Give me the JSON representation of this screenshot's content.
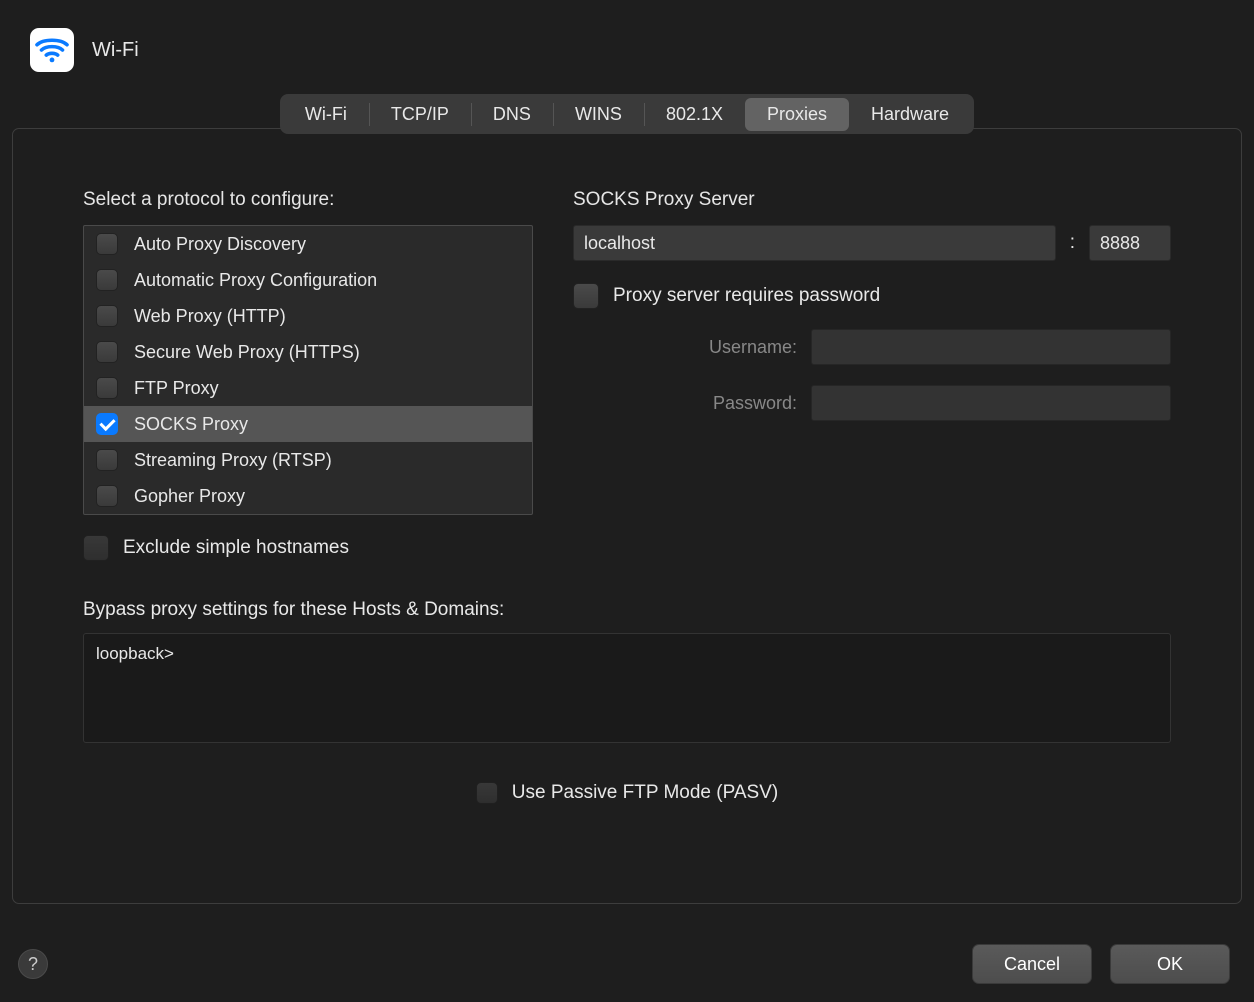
{
  "header": {
    "title": "Wi-Fi"
  },
  "tabs": {
    "items": [
      "Wi-Fi",
      "TCP/IP",
      "DNS",
      "WINS",
      "802.1X",
      "Proxies",
      "Hardware"
    ],
    "active": 5
  },
  "left": {
    "label": "Select a protocol to configure:",
    "protocols": [
      {
        "label": "Auto Proxy Discovery",
        "checked": false,
        "selected": false
      },
      {
        "label": "Automatic Proxy Configuration",
        "checked": false,
        "selected": false
      },
      {
        "label": "Web Proxy (HTTP)",
        "checked": false,
        "selected": false
      },
      {
        "label": "Secure Web Proxy (HTTPS)",
        "checked": false,
        "selected": false
      },
      {
        "label": "FTP Proxy",
        "checked": false,
        "selected": false
      },
      {
        "label": "SOCKS Proxy",
        "checked": true,
        "selected": true
      },
      {
        "label": "Streaming Proxy (RTSP)",
        "checked": false,
        "selected": false
      },
      {
        "label": "Gopher Proxy",
        "checked": false,
        "selected": false
      }
    ],
    "exclude_label": "Exclude simple hostnames",
    "exclude_checked": false
  },
  "right": {
    "server_label": "SOCKS Proxy Server",
    "host": "localhost",
    "port": "8888",
    "requires_pw_label": "Proxy server requires password",
    "requires_pw_checked": false,
    "username_label": "Username:",
    "username_value": "",
    "password_label": "Password:",
    "password_value": ""
  },
  "bypass": {
    "label": "Bypass proxy settings for these Hosts & Domains:",
    "value": "loopback>"
  },
  "pasv": {
    "label": "Use Passive FTP Mode (PASV)",
    "checked": false
  },
  "footer": {
    "help": "?",
    "cancel": "Cancel",
    "ok": "OK"
  }
}
